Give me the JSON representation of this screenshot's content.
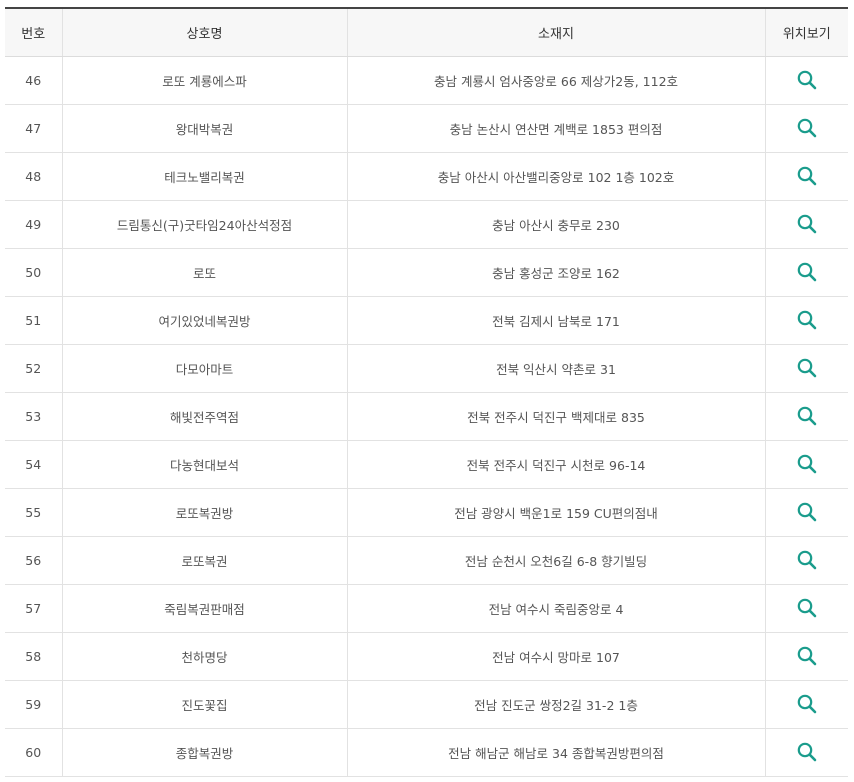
{
  "headers": {
    "no": "번호",
    "name": "상호명",
    "address": "소재지",
    "location": "위치보기"
  },
  "rows": [
    {
      "no": "46",
      "name": "로또 계룡에스파",
      "address": "충남 계룡시 엄사중앙로 66 제상가2동, 112호"
    },
    {
      "no": "47",
      "name": "왕대박복권",
      "address": "충남 논산시 연산면 계백로 1853 편의점"
    },
    {
      "no": "48",
      "name": "테크노밸리복권",
      "address": "충남 아산시 아산밸리중앙로 102 1층 102호"
    },
    {
      "no": "49",
      "name": "드림통신(구)굿타임24아산석정점",
      "address": "충남 아산시 충무로 230"
    },
    {
      "no": "50",
      "name": "로또",
      "address": "충남 홍성군 조양로 162"
    },
    {
      "no": "51",
      "name": "여기있었네복권방",
      "address": "전북 김제시 남북로 171"
    },
    {
      "no": "52",
      "name": "다모아마트",
      "address": "전북 익산시 약촌로 31"
    },
    {
      "no": "53",
      "name": "해빛전주역점",
      "address": "전북 전주시 덕진구 백제대로 835"
    },
    {
      "no": "54",
      "name": "다농현대보석",
      "address": "전북 전주시 덕진구 시천로 96-14"
    },
    {
      "no": "55",
      "name": "로또복권방",
      "address": "전남 광양시 백운1로 159 CU편의점내"
    },
    {
      "no": "56",
      "name": "로또복권",
      "address": "전남 순천시 오천6길 6-8 향기빌딩"
    },
    {
      "no": "57",
      "name": "죽림복권판매점",
      "address": "전남 여수시 죽림중앙로 4"
    },
    {
      "no": "58",
      "name": "천하명당",
      "address": "전남 여수시 망마로 107"
    },
    {
      "no": "59",
      "name": "진도꽃집",
      "address": "전남 진도군 쌍정2길 31-2 1층"
    },
    {
      "no": "60",
      "name": "종합복권방",
      "address": "전남 해남군 해남로 34 종합복권방편의점"
    }
  ],
  "icon": {
    "name": "search-icon",
    "color": "#1a9c8c"
  }
}
